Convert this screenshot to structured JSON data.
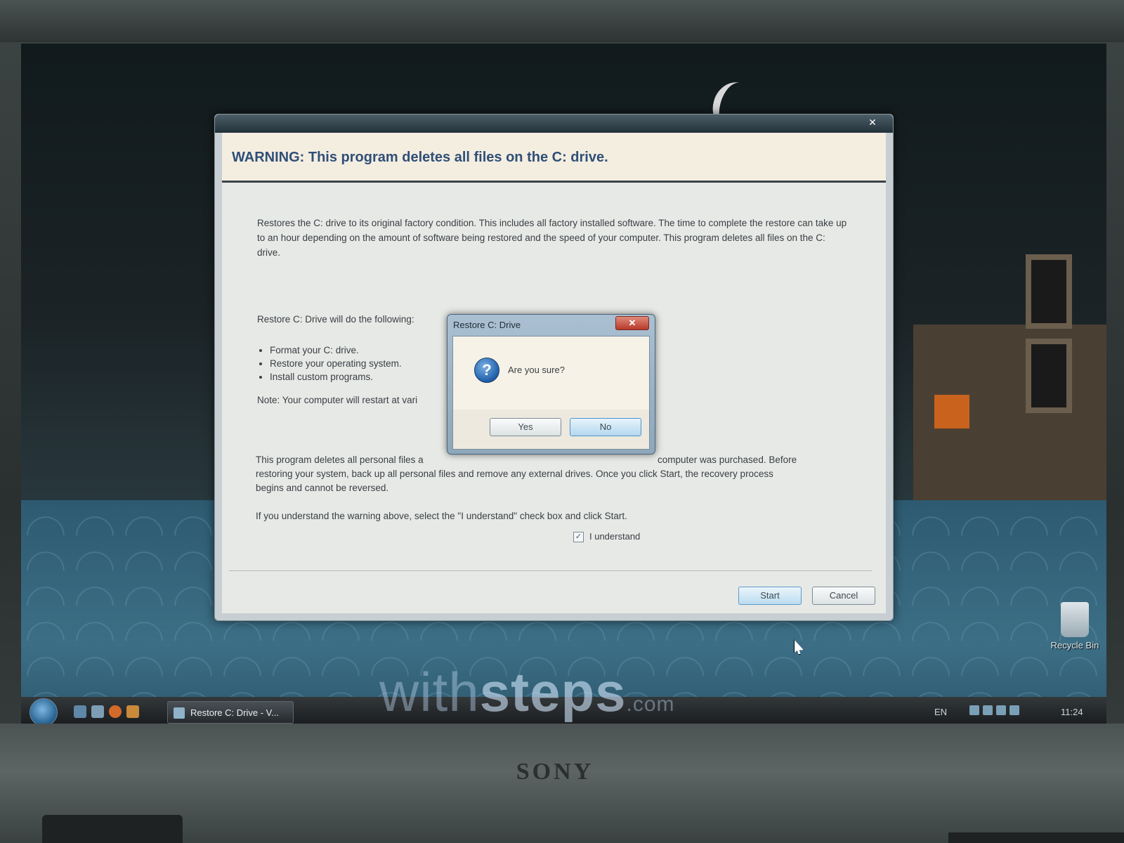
{
  "main_dialog": {
    "warning": "WARNING: This program deletes all files on the C: drive.",
    "intro": "Restores the C: drive to its original factory condition. This includes all factory installed software. The time to complete the restore can take up to an hour depending on the amount of software being restored and the speed of your computer. This program deletes all files on the C: drive.",
    "list_heading": "Restore C: Drive will do the following:",
    "steps": [
      "Format your C: drive.",
      "Restore your operating system.",
      "Install custom programs."
    ],
    "note": "Note: Your computer will restart at vari",
    "personal_files_left": "This program deletes all personal files a",
    "personal_files_right": "computer was purchased. Before",
    "personal_files_line2": "restoring your system, back up all personal files and remove any external drives. Once you click Start, the recovery process",
    "personal_files_line3": "begins and cannot be reversed.",
    "instruction": "If you understand the warning above, select the \"I understand\" check box and click Start.",
    "checkbox_label": "I understand",
    "checkbox_checked": true,
    "start_label": "Start",
    "cancel_label": "Cancel"
  },
  "confirm_dialog": {
    "title": "Restore C: Drive",
    "message": "Are you sure?",
    "yes_label": "Yes",
    "no_label": "No",
    "icon": "question-icon"
  },
  "taskbar": {
    "task_button_label": "Restore C: Drive - V...",
    "language": "EN",
    "clock": "11:24"
  },
  "desktop": {
    "recycle_bin_label": "Recycle Bin"
  },
  "laptop": {
    "brand": "SONY"
  },
  "watermark": {
    "part1": "with",
    "part2": "steps",
    "part3": ".com"
  }
}
